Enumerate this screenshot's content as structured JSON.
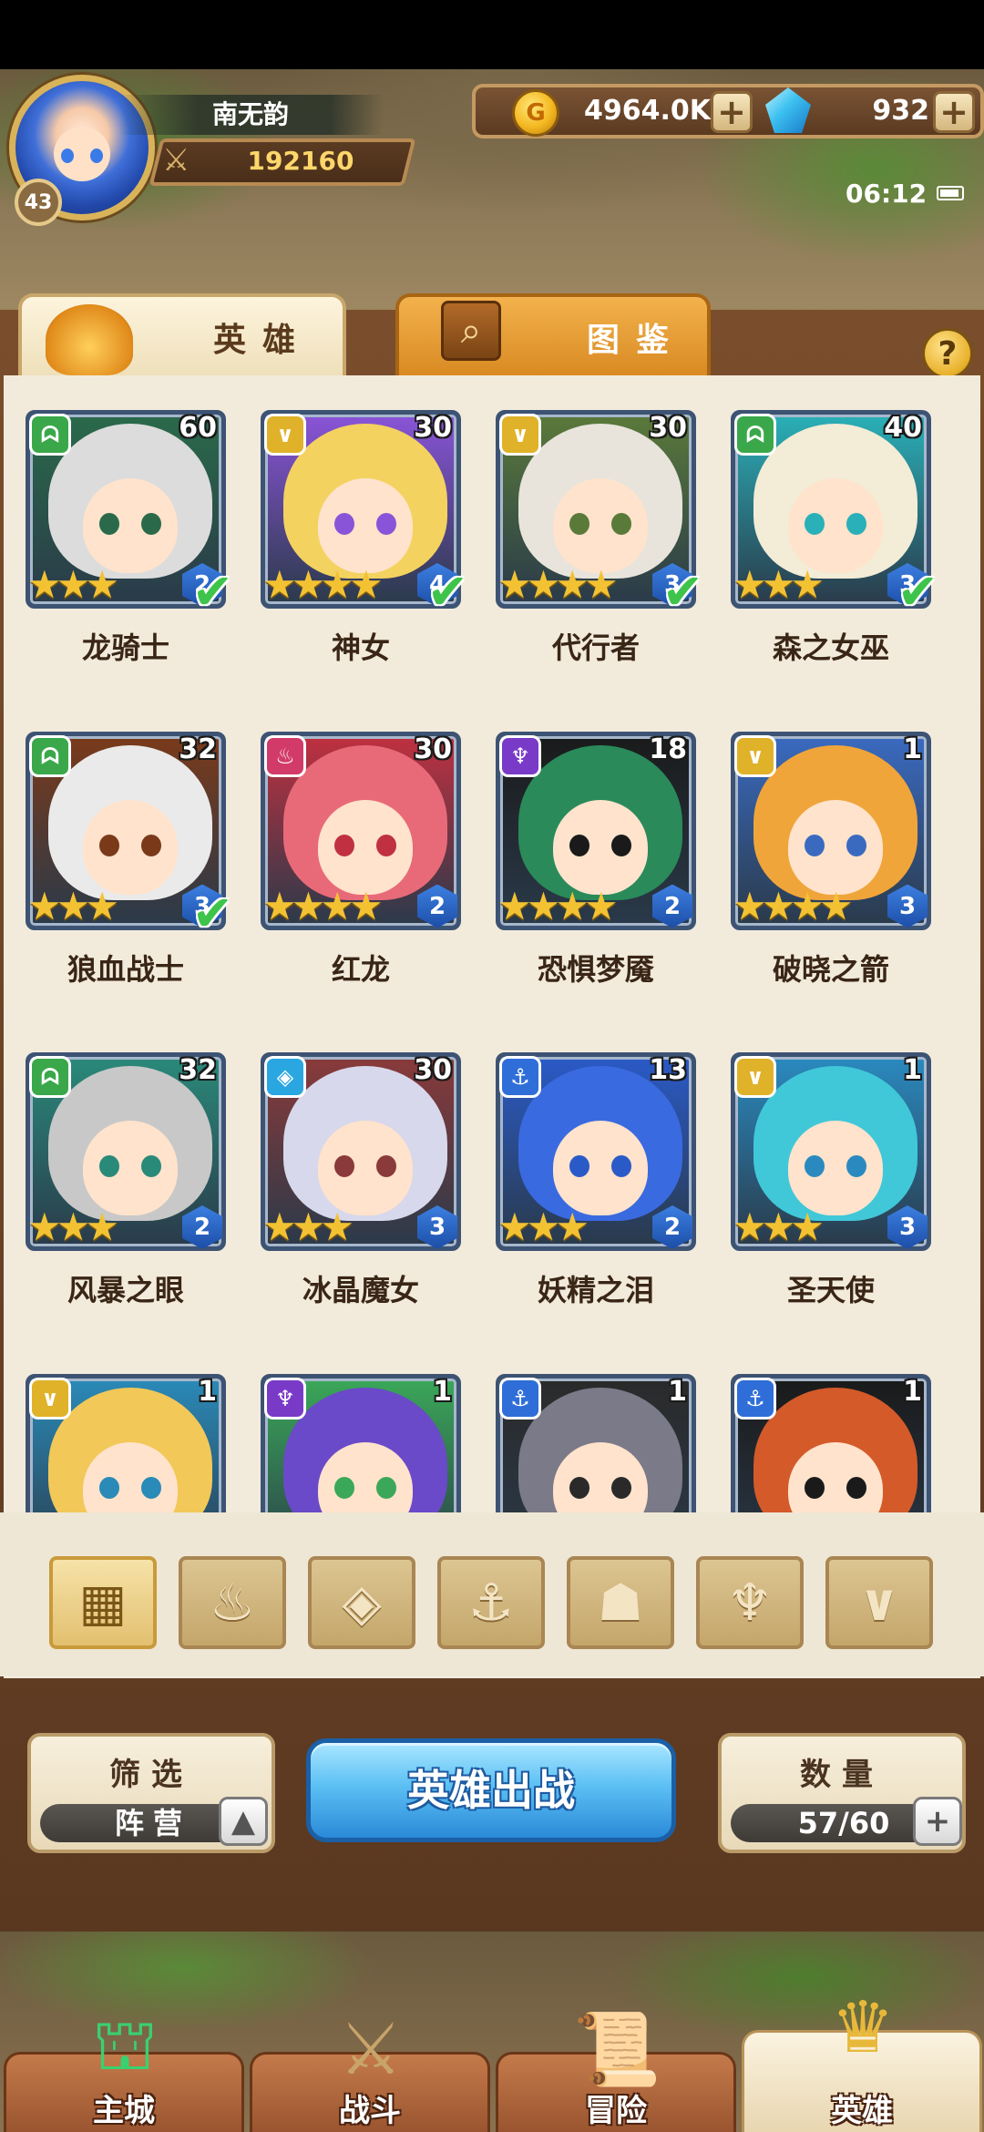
{
  "player": {
    "name": "南无韵",
    "level": "43",
    "power": "192160"
  },
  "currency": {
    "gold": "4964.0K",
    "gems": "932",
    "coin_symbol": "G",
    "plus": "+"
  },
  "status": {
    "time": "06:12"
  },
  "tabs": {
    "heroes": "英雄",
    "codex": "图鉴",
    "help": "?"
  },
  "heroes": [
    {
      "name": "龙骑士",
      "level": "60",
      "rank": "2",
      "stars": 3,
      "faction": "beast",
      "deployed": true
    },
    {
      "name": "神女",
      "level": "30",
      "rank": "4",
      "stars": 4,
      "faction": "holy",
      "deployed": true
    },
    {
      "name": "代行者",
      "level": "30",
      "rank": "3",
      "stars": 4,
      "faction": "holy",
      "deployed": true
    },
    {
      "name": "森之女巫",
      "level": "40",
      "rank": "3",
      "stars": 3,
      "faction": "beast",
      "deployed": true
    },
    {
      "name": "狼血战士",
      "level": "32",
      "rank": "3",
      "stars": 3,
      "faction": "beast",
      "deployed": true
    },
    {
      "name": "红龙",
      "level": "30",
      "rank": "2",
      "stars": 4,
      "faction": "fire",
      "deployed": false
    },
    {
      "name": "恐惧梦魇",
      "level": "18",
      "rank": "2",
      "stars": 4,
      "faction": "dark",
      "deployed": false
    },
    {
      "name": "破晓之箭",
      "level": "1",
      "rank": "3",
      "stars": 4,
      "faction": "holy",
      "deployed": false
    },
    {
      "name": "风暴之眼",
      "level": "32",
      "rank": "2",
      "stars": 3,
      "faction": "beast",
      "deployed": false
    },
    {
      "name": "冰晶魔女",
      "level": "30",
      "rank": "3",
      "stars": 3,
      "faction": "crystal",
      "deployed": false
    },
    {
      "name": "妖精之泪",
      "level": "13",
      "rank": "2",
      "stars": 3,
      "faction": "anchor",
      "deployed": false
    },
    {
      "name": "圣天使",
      "level": "1",
      "rank": "3",
      "stars": 3,
      "faction": "holy",
      "deployed": false
    },
    {
      "name": "",
      "level": "1",
      "rank": "",
      "stars": 0,
      "faction": "holy",
      "deployed": false
    },
    {
      "name": "",
      "level": "1",
      "rank": "",
      "stars": 0,
      "faction": "dark",
      "deployed": false
    },
    {
      "name": "",
      "level": "1",
      "rank": "",
      "stars": 0,
      "faction": "anchor",
      "deployed": false
    },
    {
      "name": "",
      "level": "1",
      "rank": "",
      "stars": 0,
      "faction": "anchor",
      "deployed": false
    }
  ],
  "faction_colors": {
    "beast": "#3aa84a",
    "holy": "#e0b22a",
    "fire": "#d23a6a",
    "dark": "#7a3ac8",
    "crystal": "#2aa7e0",
    "anchor": "#2f6ed8"
  },
  "filters": [
    {
      "icon": "grid-icon",
      "glyph": "▦",
      "active": true
    },
    {
      "icon": "fire-icon",
      "glyph": "♨",
      "active": false
    },
    {
      "icon": "crystal-icon",
      "glyph": "◈",
      "active": false
    },
    {
      "icon": "anchor-icon",
      "glyph": "⚓",
      "active": false
    },
    {
      "icon": "beast-icon",
      "glyph": "☗",
      "active": false
    },
    {
      "icon": "dark-icon",
      "glyph": "♆",
      "active": false
    },
    {
      "icon": "holy-icon",
      "glyph": "∨",
      "active": false
    }
  ],
  "controls": {
    "filter_title": "筛选",
    "filter_value": "阵营",
    "deploy": "英雄出战",
    "count_title": "数量",
    "count_value": "57/60"
  },
  "nav": [
    {
      "label": "主城",
      "icon": "castle-icon",
      "active": false
    },
    {
      "label": "战斗",
      "icon": "swords-icon",
      "active": false
    },
    {
      "label": "冒险",
      "icon": "scroll-icon",
      "active": false
    },
    {
      "label": "英雄",
      "icon": "hero-helmet-icon",
      "active": true
    }
  ]
}
